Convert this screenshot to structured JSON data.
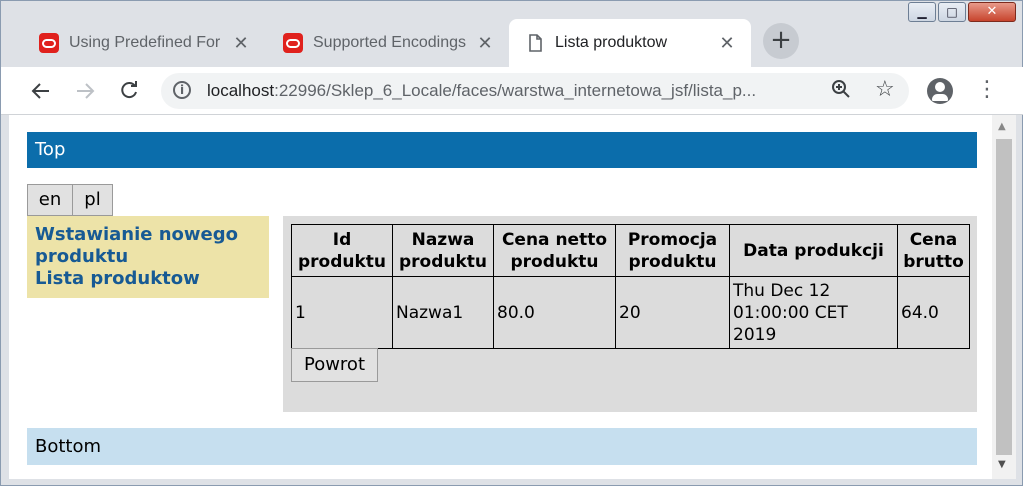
{
  "window": {
    "controls": {
      "minimize": "▁",
      "maximize": "□",
      "close": "✕"
    }
  },
  "tabs": [
    {
      "title": "Using Predefined For",
      "icon": "oracle-icon",
      "active": false
    },
    {
      "title": "Supported Encodings",
      "icon": "oracle-icon",
      "active": false
    },
    {
      "title": "Lista produktow",
      "icon": "document-icon",
      "active": true
    }
  ],
  "toolbar": {
    "url_host": "localhost",
    "url_path": ":22996/Sklep_6_Locale/faces/warstwa_internetowa_jsf/lista_p..."
  },
  "page": {
    "top_text": "Top",
    "bottom_text": "Bottom",
    "lang_buttons": [
      "en",
      "pl"
    ],
    "nav_links": [
      "Wstawianie nowego produktu",
      "Lista produktow"
    ],
    "table": {
      "headers": [
        "Id produktu",
        "Nazwa produktu",
        "Cena netto produktu",
        "Promocja produktu",
        "Data produkcji",
        "Cena brutto"
      ],
      "rows": [
        [
          "1",
          "Nazwa1",
          "80.0",
          "20",
          "Thu Dec 12 01:00:00 CET 2019",
          "64.0"
        ]
      ]
    },
    "back_button": "Powrot"
  },
  "colors": {
    "top_bar": "#0b6dab",
    "bottom_bar": "#c6dfef",
    "left_nav_bg": "#ede3a8",
    "link": "#175a94",
    "content_bg": "#dcdcdc"
  }
}
